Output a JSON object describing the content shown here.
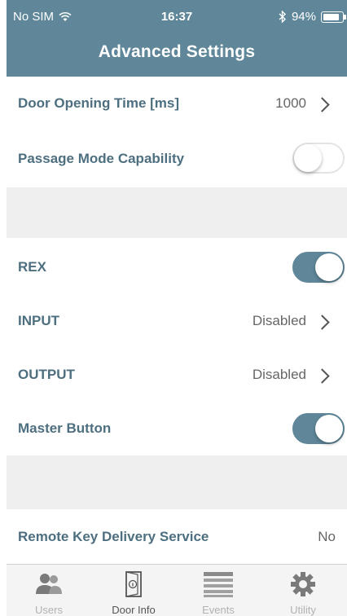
{
  "status_bar": {
    "carrier": "No SIM",
    "wifi_icon": "wifi-icon",
    "time": "16:37",
    "bluetooth_icon": "bluetooth-icon",
    "battery_percent": "94%",
    "battery_level": 0.94
  },
  "header": {
    "title": "Advanced Settings"
  },
  "settings": {
    "door_opening_time": {
      "label": "Door Opening Time [ms]",
      "value": "1000"
    },
    "passage_mode": {
      "label": "Passage Mode Capability",
      "enabled": false
    },
    "rex": {
      "label": "REX",
      "enabled": true
    },
    "input": {
      "label": "INPUT",
      "value": "Disabled"
    },
    "output": {
      "label": "OUTPUT",
      "value": "Disabled"
    },
    "master_button": {
      "label": "Master Button",
      "enabled": true
    },
    "remote_key": {
      "label": "Remote Key Delivery Service",
      "value": "No"
    }
  },
  "tabs": [
    {
      "label": "Users",
      "icon": "users-icon",
      "active": false
    },
    {
      "label": "Door Info",
      "icon": "door-info-icon",
      "active": true
    },
    {
      "label": "Events",
      "icon": "events-list-icon",
      "active": false
    },
    {
      "label": "Utility",
      "icon": "gear-icon",
      "active": false
    }
  ],
  "colors": {
    "accent": "#5f8799",
    "label_text": "#4d6f80",
    "section_gap": "#efefef"
  }
}
